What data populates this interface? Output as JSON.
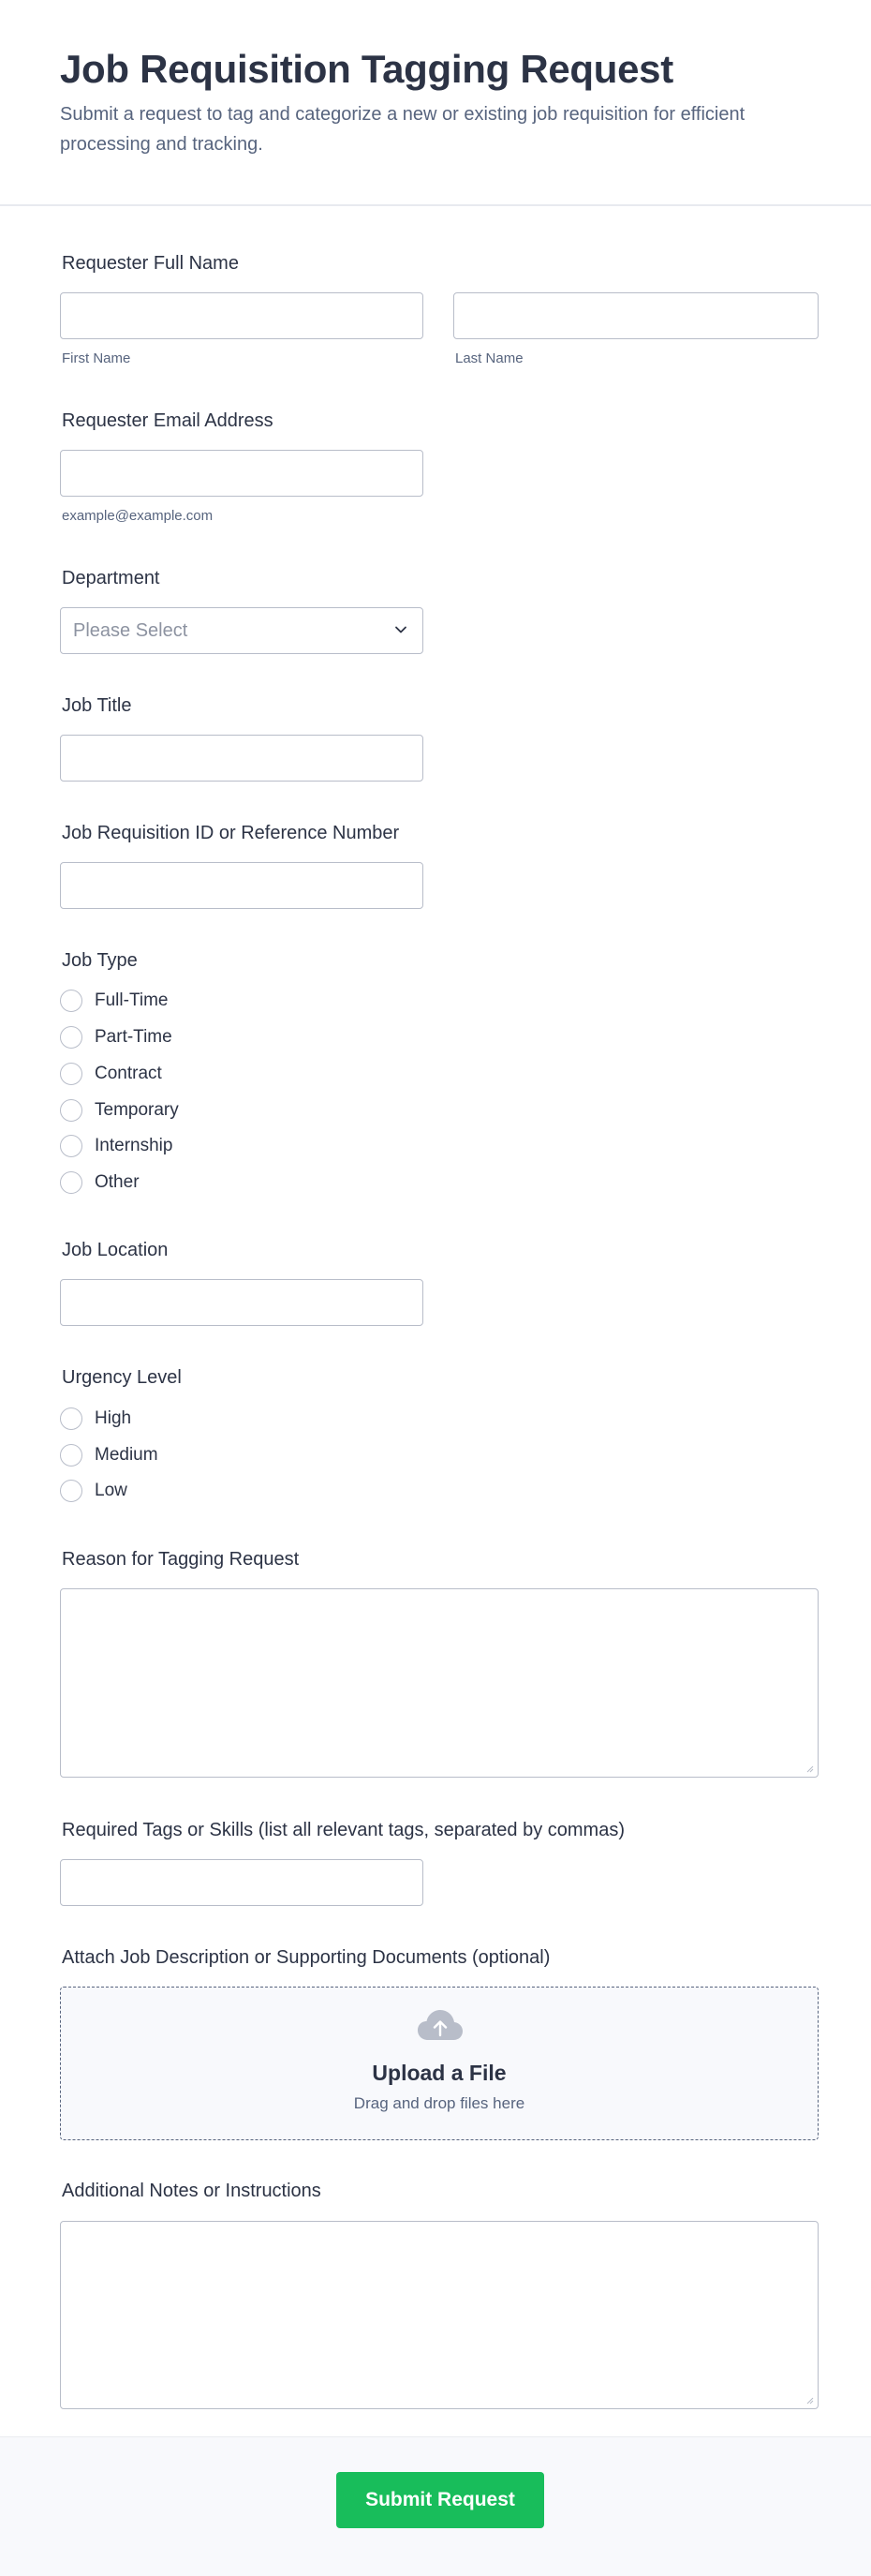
{
  "form": {
    "title": "Job Requisition Tagging Request",
    "subtitle": "Submit a request to tag and categorize a new or existing job requisition for efficient processing and tracking."
  },
  "requester_name": {
    "label": "Requester Full Name",
    "first_sublabel": "First Name",
    "last_sublabel": "Last Name",
    "first_value": "",
    "last_value": ""
  },
  "email": {
    "label": "Requester Email Address",
    "sublabel": "example@example.com",
    "value": ""
  },
  "department": {
    "label": "Department",
    "placeholder": "Please Select",
    "selected": ""
  },
  "job_title": {
    "label": "Job Title",
    "value": ""
  },
  "requisition_id": {
    "label": "Job Requisition ID or Reference Number",
    "value": ""
  },
  "job_type": {
    "label": "Job Type",
    "options": [
      "Full-Time",
      "Part-Time",
      "Contract",
      "Temporary",
      "Internship",
      "Other"
    ],
    "selected": null
  },
  "job_location": {
    "label": "Job Location",
    "value": ""
  },
  "urgency": {
    "label": "Urgency Level",
    "options": [
      "High",
      "Medium",
      "Low"
    ],
    "selected": null
  },
  "reason": {
    "label": "Reason for Tagging Request",
    "value": ""
  },
  "tags": {
    "label": "Required Tags or Skills (list all relevant tags, separated by commas)",
    "value": ""
  },
  "attachment": {
    "label": "Attach Job Description or Supporting Documents (optional)",
    "upload_title": "Upload a File",
    "upload_hint": "Drag and drop files here",
    "icon": "cloud-upload-icon"
  },
  "notes": {
    "label": "Additional Notes or Instructions",
    "value": ""
  },
  "submit": {
    "label": "Submit Request"
  },
  "colors": {
    "primary_text": "#2c3345",
    "secondary_text": "#57647e",
    "border": "#b8bdc9",
    "submit_bg": "#18bd5b",
    "footer_bg": "#f8f9fc"
  }
}
